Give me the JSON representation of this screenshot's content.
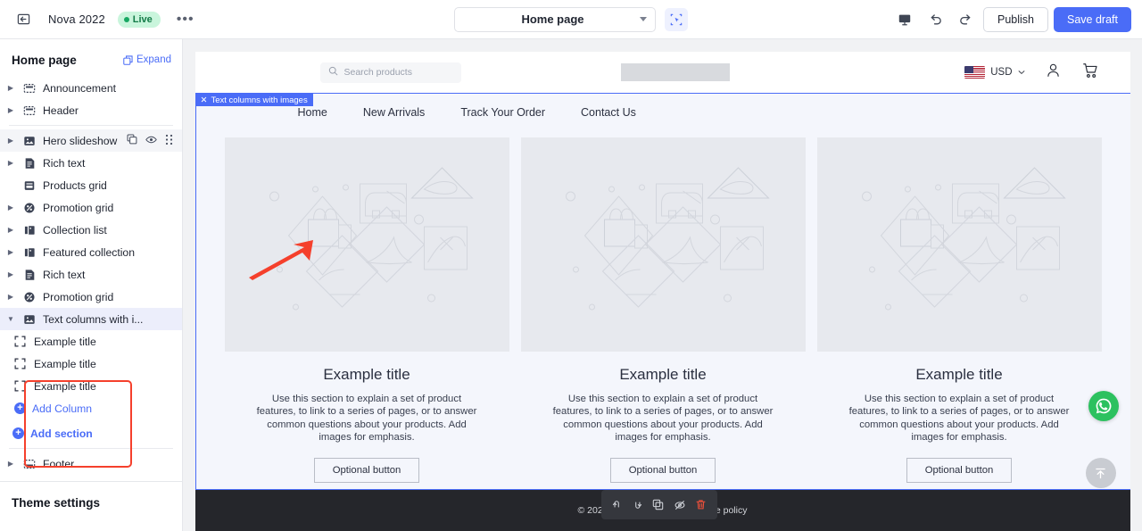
{
  "topbar": {
    "back_icon": "back-arrow-icon",
    "store_name": "Nova 2022",
    "live_label": "Live",
    "more_label": "•••",
    "page_selector_value": "Home page",
    "select_tool_icon": "selection-tool-icon",
    "device_icon": "desktop-preview-icon",
    "undo_icon": "undo-icon",
    "redo_icon": "redo-icon",
    "publish_label": "Publish",
    "save_draft_label": "Save draft"
  },
  "sidebar": {
    "title": "Home page",
    "expand_label": "Expand",
    "items": [
      {
        "label": "Announcement",
        "icon": "announcement-icon",
        "twisty": true,
        "state": "normal"
      },
      {
        "label": "Header",
        "icon": "header-icon",
        "twisty": true,
        "state": "normal"
      },
      {
        "label": "Hero slideshow",
        "icon": "image-icon",
        "twisty": true,
        "state": "hovered"
      },
      {
        "label": "Rich text",
        "icon": "document-icon",
        "twisty": true,
        "state": "normal"
      },
      {
        "label": "Products grid",
        "icon": "products-grid-icon",
        "twisty": false,
        "state": "normal"
      },
      {
        "label": "Promotion grid",
        "icon": "promotion-icon",
        "twisty": true,
        "state": "normal"
      },
      {
        "label": "Collection list",
        "icon": "collection-icon",
        "twisty": true,
        "state": "normal"
      },
      {
        "label": "Featured collection",
        "icon": "collection-icon",
        "twisty": true,
        "state": "normal"
      },
      {
        "label": "Rich text",
        "icon": "document-icon",
        "twisty": true,
        "state": "normal"
      },
      {
        "label": "Promotion grid",
        "icon": "promotion-icon",
        "twisty": true,
        "state": "normal"
      },
      {
        "label": "Text columns with i...",
        "icon": "image-icon",
        "twisty": true,
        "state": "selected"
      }
    ],
    "row_actions": {
      "duplicate_icon": "duplicate-icon",
      "visibility_icon": "eye-icon",
      "drag_icon": "drag-handle-icon"
    },
    "columns": [
      {
        "label": "Example title",
        "icon": "block-icon"
      },
      {
        "label": "Example title",
        "icon": "block-icon"
      },
      {
        "label": "Example title",
        "icon": "block-icon"
      }
    ],
    "add_column_label": "Add Column",
    "add_section_label": "Add section",
    "footer_item": {
      "label": "Footer",
      "icon": "footer-icon"
    },
    "theme_settings_label": "Theme settings"
  },
  "preview": {
    "section_tag": {
      "close_icon": "close-icon",
      "label": "Text columns with images"
    },
    "store_header": {
      "search_placeholder": "Search products",
      "search_icon": "search-icon",
      "currency": "USD",
      "currency_flag": "us-flag-icon",
      "currency_caret": "chevron-down-icon",
      "account_icon": "user-account-icon",
      "cart_icon": "shopping-cart-icon"
    },
    "nav": [
      "Home",
      "New Arrivals",
      "Track Your Order",
      "Contact Us"
    ],
    "columns": [
      {
        "image": "placeholder-product-illustration",
        "title": "Example title",
        "body": "Use this section to explain a set of product features, to link to a series of pages, or to answer common questions about your products. Add images for emphasis.",
        "button": "Optional button"
      },
      {
        "image": "placeholder-product-illustration",
        "title": "Example title",
        "body": "Use this section to explain a set of product features, to link to a series of pages, or to answer common questions about your products. Add images for emphasis.",
        "button": "Optional button"
      },
      {
        "image": "placeholder-product-illustration",
        "title": "Example title",
        "body": "Use this section to explain a set of product features, to link to a series of pages, or to answer common questions about your products. Add images for emphasis.",
        "button": "Optional button"
      }
    ],
    "footer": {
      "copyright": "© 2023 testing12310",
      "store_policy": "Store policy"
    },
    "float_toolbar": [
      {
        "icon": "move-up-icon"
      },
      {
        "icon": "move-down-icon"
      },
      {
        "icon": "duplicate-icon"
      },
      {
        "icon": "hide-icon"
      },
      {
        "icon": "delete-icon"
      }
    ],
    "whatsapp_icon": "whatsapp-icon",
    "scroll_top_icon": "scroll-to-top-icon"
  },
  "colors": {
    "accent": "#4a6cf7",
    "live": "#17a862",
    "annotation": "#f5402c",
    "danger": "#f4503a",
    "whatsapp": "#2cc15f"
  }
}
